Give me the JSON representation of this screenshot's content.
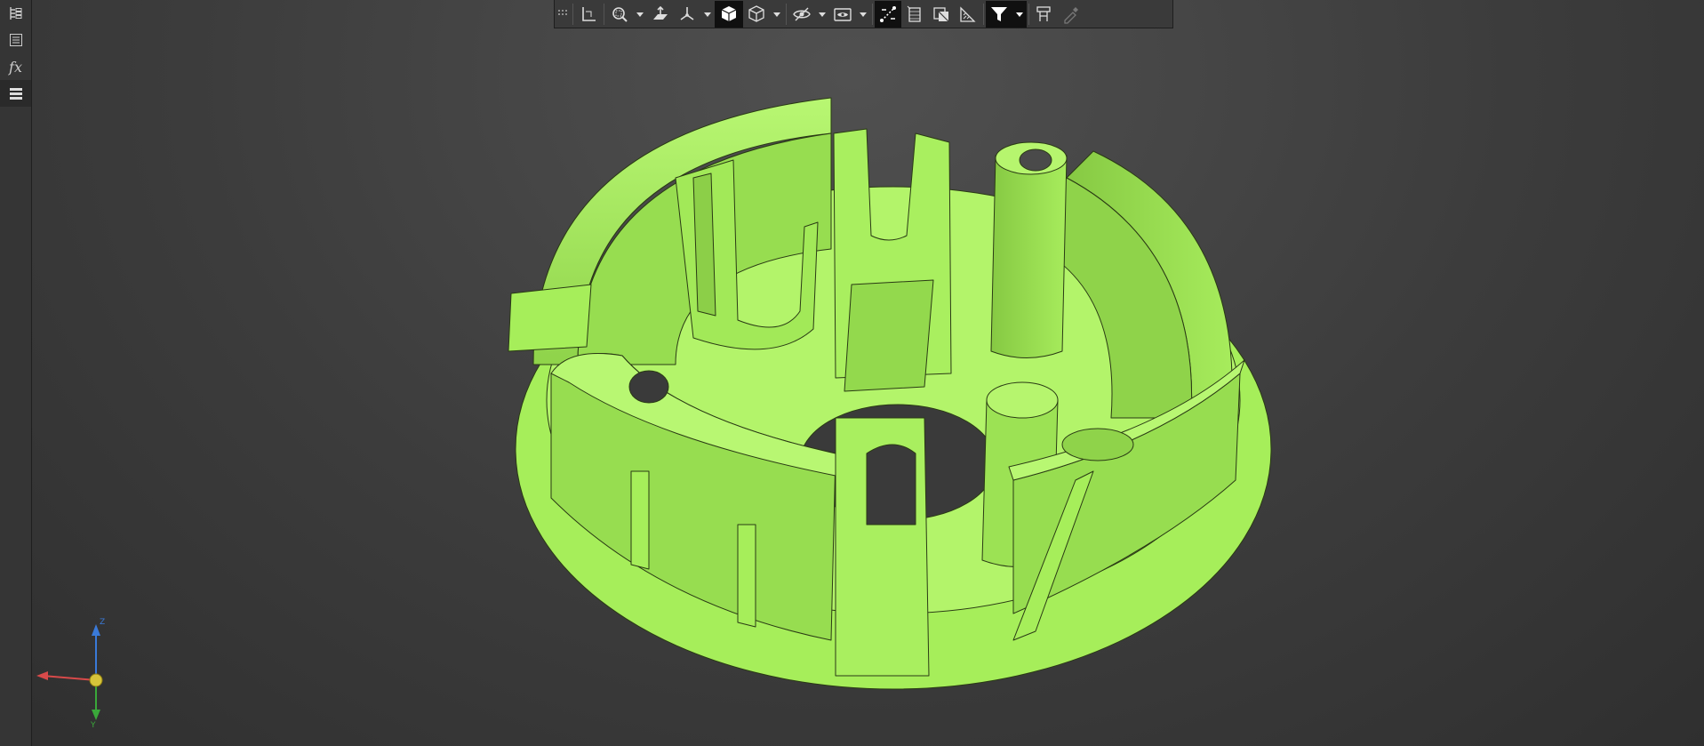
{
  "side_panel": {
    "items": [
      {
        "name": "feature-tree",
        "icon": "tree-list-icon"
      },
      {
        "name": "properties",
        "icon": "property-sheet-icon"
      },
      {
        "name": "formula",
        "icon": "fx-icon",
        "label": "fx"
      },
      {
        "name": "layers",
        "icon": "layers-icon"
      }
    ]
  },
  "toolbar": {
    "buttons": [
      {
        "name": "grip",
        "icon": "grip-dots-icon"
      },
      {
        "name": "sketch-plane",
        "icon": "plane-axes-icon"
      },
      {
        "name": "zoom",
        "icon": "zoom-window-icon",
        "has_dropdown": true
      },
      {
        "name": "view-normal",
        "icon": "view-normal-icon"
      },
      {
        "name": "view-orientation",
        "icon": "triad-view-icon",
        "has_dropdown": true
      },
      {
        "name": "shaded",
        "icon": "solid-cube-icon",
        "active": true
      },
      {
        "name": "wireframe",
        "icon": "wire-cube-icon",
        "has_dropdown": true
      },
      {
        "name": "hide-show",
        "icon": "eye-hide-icon",
        "has_dropdown": true
      },
      {
        "name": "view-filter",
        "icon": "camera-eye-icon",
        "has_dropdown": true
      },
      {
        "name": "measure",
        "icon": "measure-path-icon",
        "active": true
      },
      {
        "name": "section",
        "icon": "section-plane-icon"
      },
      {
        "name": "appearance",
        "icon": "appearance-icon"
      },
      {
        "name": "draft",
        "icon": "draft-analysis-icon"
      },
      {
        "name": "selection-filter",
        "icon": "filter-funnel-icon",
        "active": true,
        "has_dropdown": true
      },
      {
        "name": "render-settings",
        "icon": "render-settings-icon"
      },
      {
        "name": "eyedropper",
        "icon": "eyedropper-icon",
        "disabled": true
      }
    ]
  },
  "viewport": {
    "background_top": "#505050",
    "background_bottom": "#2f2f2f",
    "model_color": "#a6ee5a",
    "model_shade": "#82c23e",
    "model_edge": "#2a3a14"
  },
  "axis_triad": {
    "z_label": "Z",
    "y_label": "Y",
    "x_color": "#d84a4a",
    "y_color": "#3aa83a",
    "z_color": "#3a7ad8"
  }
}
